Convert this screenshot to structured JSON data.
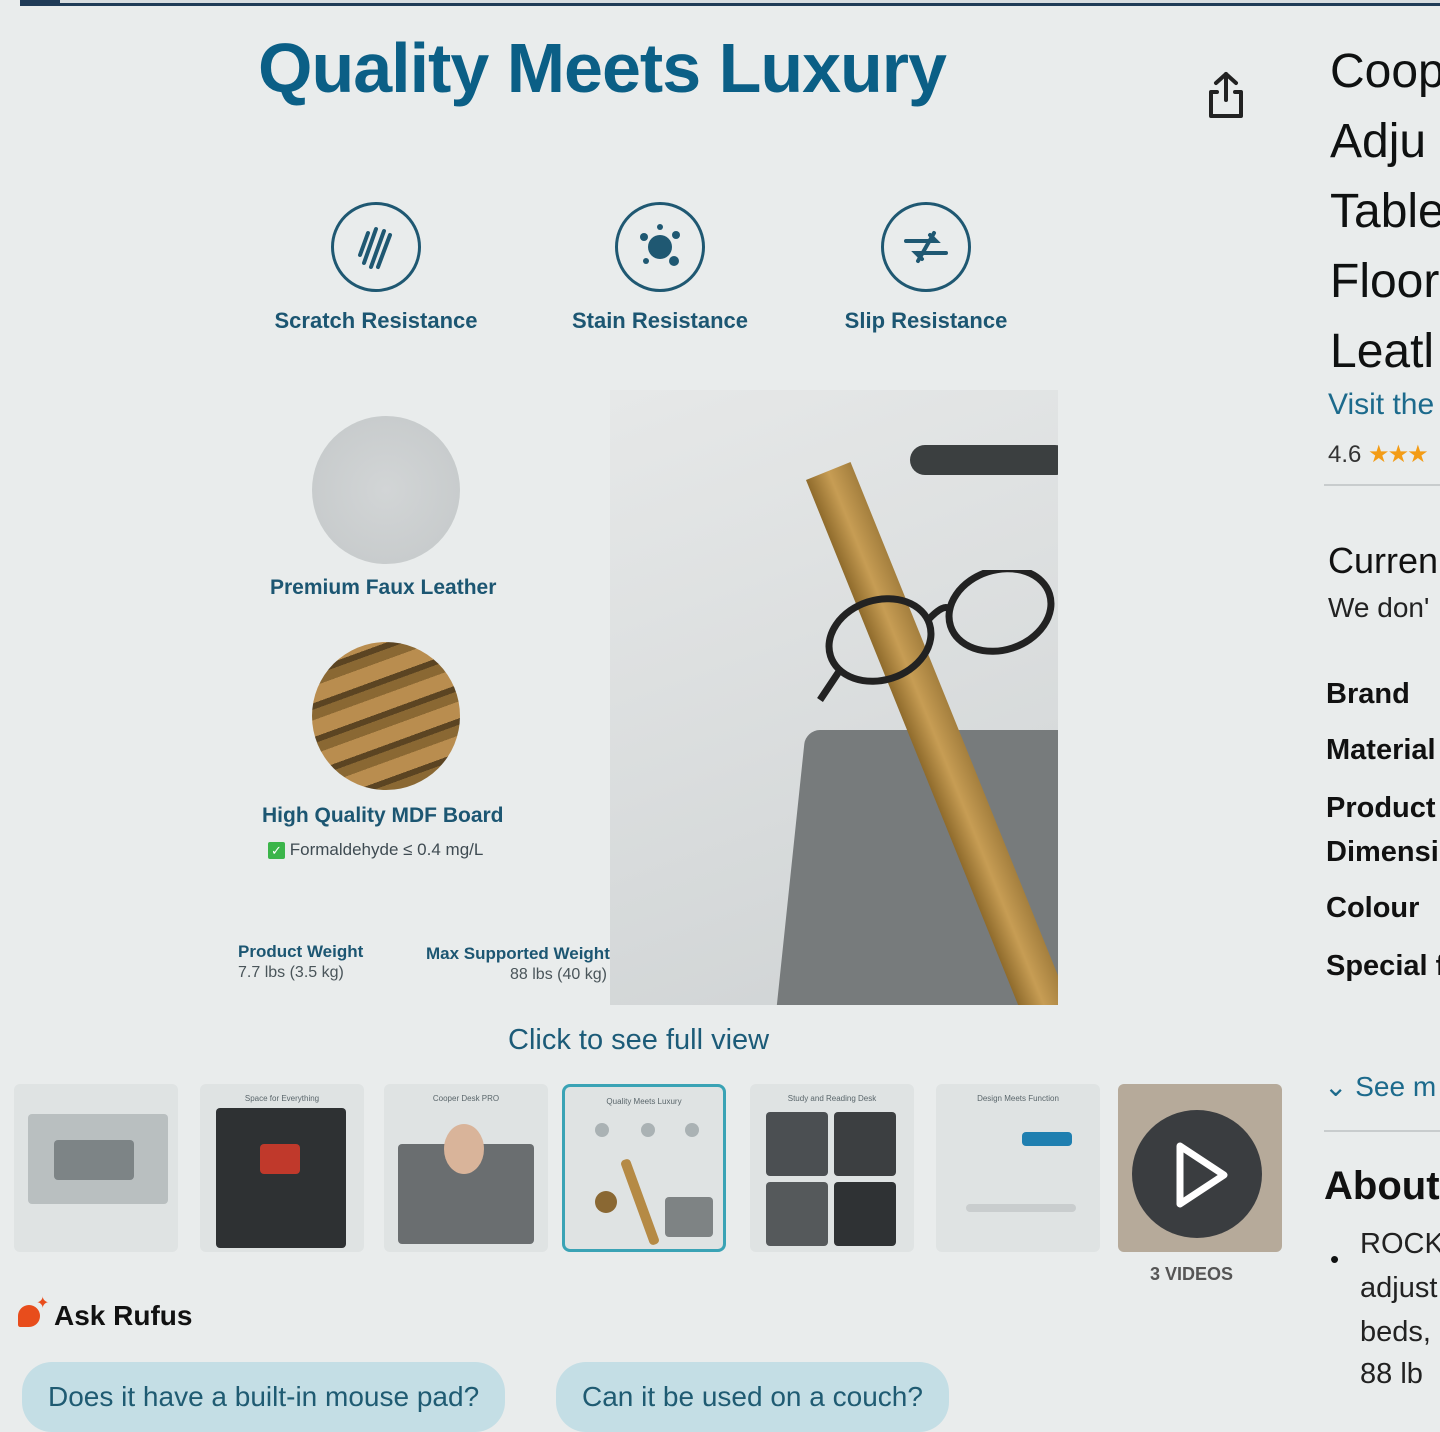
{
  "hero": {
    "title": "Quality Meets Luxury",
    "features": [
      {
        "label": "Scratch Resistance",
        "icon": "scratch-icon"
      },
      {
        "label": "Stain Resistance",
        "icon": "stain-icon"
      },
      {
        "label": "Slip Resistance",
        "icon": "slip-icon"
      }
    ],
    "callouts": {
      "faux_leather": "Premium Faux Leather",
      "mdf": "High Quality MDF Board",
      "formaldehyde": "Formaldehyde ≤ 0.4 mg/L"
    },
    "specs": {
      "weight_label": "Product Weight",
      "weight_value": "7.7 lbs (3.5 kg)",
      "max_label": "Max Supported Weight",
      "max_value": "88 lbs (40 kg)"
    },
    "full_view": "Click to see full view"
  },
  "thumbnails": {
    "titles": [
      "",
      "Space for Everything",
      "Cooper Desk PRO",
      "Quality Meets Luxury",
      "Study and Reading Desk",
      "Design Meets Function",
      ""
    ],
    "selected_index": 3,
    "videos_label": "3 VIDEOS"
  },
  "rufus": {
    "label": "Ask Rufus",
    "questions": [
      "Does it have a built-in mouse pad?",
      "Can it be used on a couch?"
    ]
  },
  "product": {
    "title_lines": [
      "Coop",
      "Adju",
      "Table",
      "Floor",
      "Leatl"
    ],
    "visit": "Visit the",
    "rating": "4.6",
    "availability_title": "Curren",
    "availability_text": "We don'",
    "attributes": [
      "Brand",
      "Material",
      "Product",
      "Dimensi",
      "Colour",
      "Special f"
    ],
    "see_more": "See m",
    "about": "About",
    "bullet_lines": [
      "ROCK",
      "adjust",
      "beds,",
      "88 lb"
    ]
  },
  "colors": {
    "brand_teal": "#0b5f86",
    "link": "#1c6a8c",
    "star": "#f39c16",
    "selected_border": "#3aa3b5"
  }
}
